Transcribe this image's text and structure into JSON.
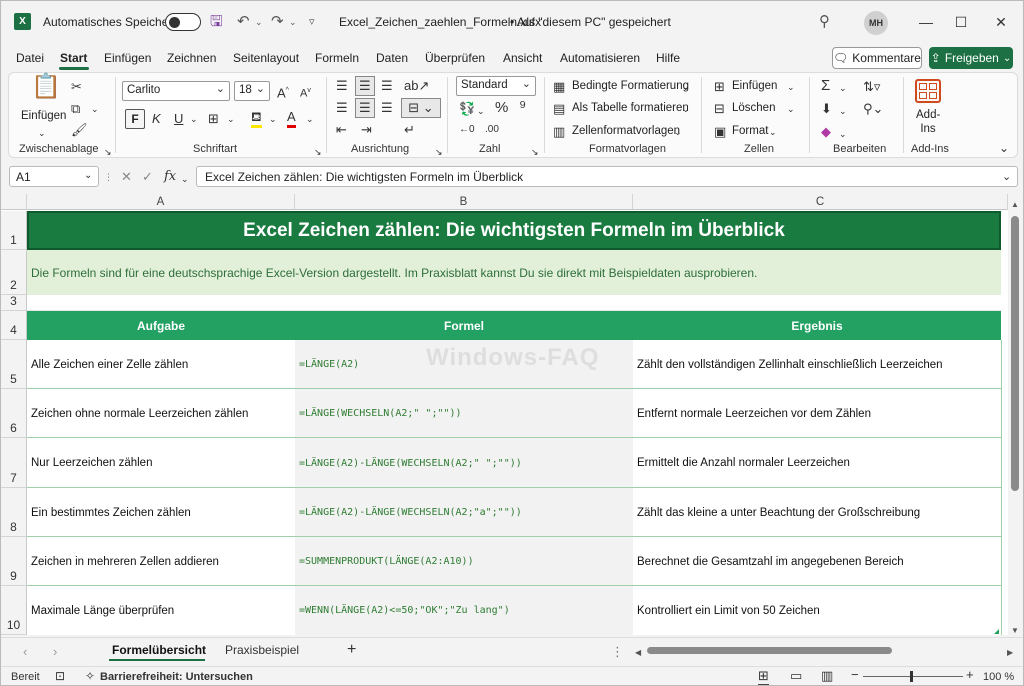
{
  "titlebar": {
    "autosave_label": "Automatisches Speichern",
    "file_title": "Excel_Zeichen_zaehlen_Formeln.xlsx",
    "save_location": "• Auf \"diesem PC\" gespeichert",
    "avatar_initials": "MH"
  },
  "menu": {
    "items": [
      "Datei",
      "Start",
      "Einfügen",
      "Zeichnen",
      "Seitenlayout",
      "Formeln",
      "Daten",
      "Überprüfen",
      "Ansicht",
      "Automatisieren",
      "Hilfe"
    ],
    "active": "Start",
    "comments_label": "Kommentare",
    "share_label": "Freigeben"
  },
  "ribbon": {
    "clipboard": {
      "paste_label": "Einfügen",
      "group_label": "Zwischenablage"
    },
    "font": {
      "family": "Carlito",
      "size": "18",
      "bold": "F",
      "italic": "K",
      "underline": "U",
      "group_label": "Schriftart"
    },
    "alignment": {
      "group_label": "Ausrichtung"
    },
    "number": {
      "format": "Standard",
      "group_label": "Zahl"
    },
    "styles": {
      "conditional": "Bedingte Formatierung",
      "as_table": "Als Tabelle formatieren",
      "cell_styles": "Zellenformatvorlagen",
      "group_label": "Formatvorlagen"
    },
    "cells": {
      "insert": "Einfügen",
      "delete": "Löschen",
      "format": "Format",
      "group_label": "Zellen"
    },
    "editing": {
      "group_label": "Bearbeiten"
    },
    "addins": {
      "label": "Add-Ins",
      "group_label": "Add-Ins"
    }
  },
  "formula_bar": {
    "name_box": "A1",
    "fx": "fx",
    "content": "Excel Zeichen zählen: Die wichtigsten Formeln im Überblick"
  },
  "sheet": {
    "columns": [
      "A",
      "B",
      "C"
    ],
    "rows": [
      "1",
      "2",
      "3",
      "4",
      "5",
      "6",
      "7",
      "8",
      "9",
      "10"
    ],
    "title": "Excel Zeichen zählen: Die wichtigsten Formeln im Überblick",
    "subtitle": "Die Formeln sind für eine deutschsprachige Excel-Version dargestellt. Im Praxisblatt kannst Du sie direkt mit Beispieldaten ausprobieren.",
    "headers": [
      "Aufgabe",
      "Formel",
      "Ergebnis"
    ],
    "data": [
      [
        "Alle Zeichen einer Zelle zählen",
        "=LÄNGE(A2)",
        "Zählt den vollständigen Zellinhalt einschließlich Leerzeichen"
      ],
      [
        "Zeichen ohne normale Leerzeichen zählen",
        "=LÄNGE(WECHSELN(A2;\" \";\"\"))",
        "Entfernt normale Leerzeichen vor dem Zählen"
      ],
      [
        "Nur Leerzeichen zählen",
        "=LÄNGE(A2)-LÄNGE(WECHSELN(A2;\" \";\"\"))",
        "Ermittelt die Anzahl normaler Leerzeichen"
      ],
      [
        "Ein bestimmtes Zeichen zählen",
        "=LÄNGE(A2)-LÄNGE(WECHSELN(A2;\"a\";\"\"))",
        "Zählt das kleine a unter Beachtung der Großschreibung"
      ],
      [
        "Zeichen in mehreren Zellen addieren",
        "=SUMMENPRODUKT(LÄNGE(A2:A10))",
        "Berechnet die Gesamtzahl im angegebenen Bereich"
      ],
      [
        "Maximale Länge überprüfen",
        "=WENN(LÄNGE(A2)<=50;\"OK\";\"Zu lang\")",
        "Kontrolliert ein Limit von 50 Zeichen"
      ]
    ],
    "watermark": "Windows-FAQ"
  },
  "tabs": {
    "items": [
      "Formelübersicht",
      "Praxisbeispiel"
    ],
    "add": "+"
  },
  "status": {
    "ready": "Bereit",
    "accessibility": "Barrierefreiheit: Untersuchen",
    "zoom": "100 %"
  },
  "colors": {
    "title_bg": "#1a7b41",
    "header_bg": "#22a163",
    "subtitle_bg": "#e2f0d9",
    "brand": "#1d7044"
  }
}
